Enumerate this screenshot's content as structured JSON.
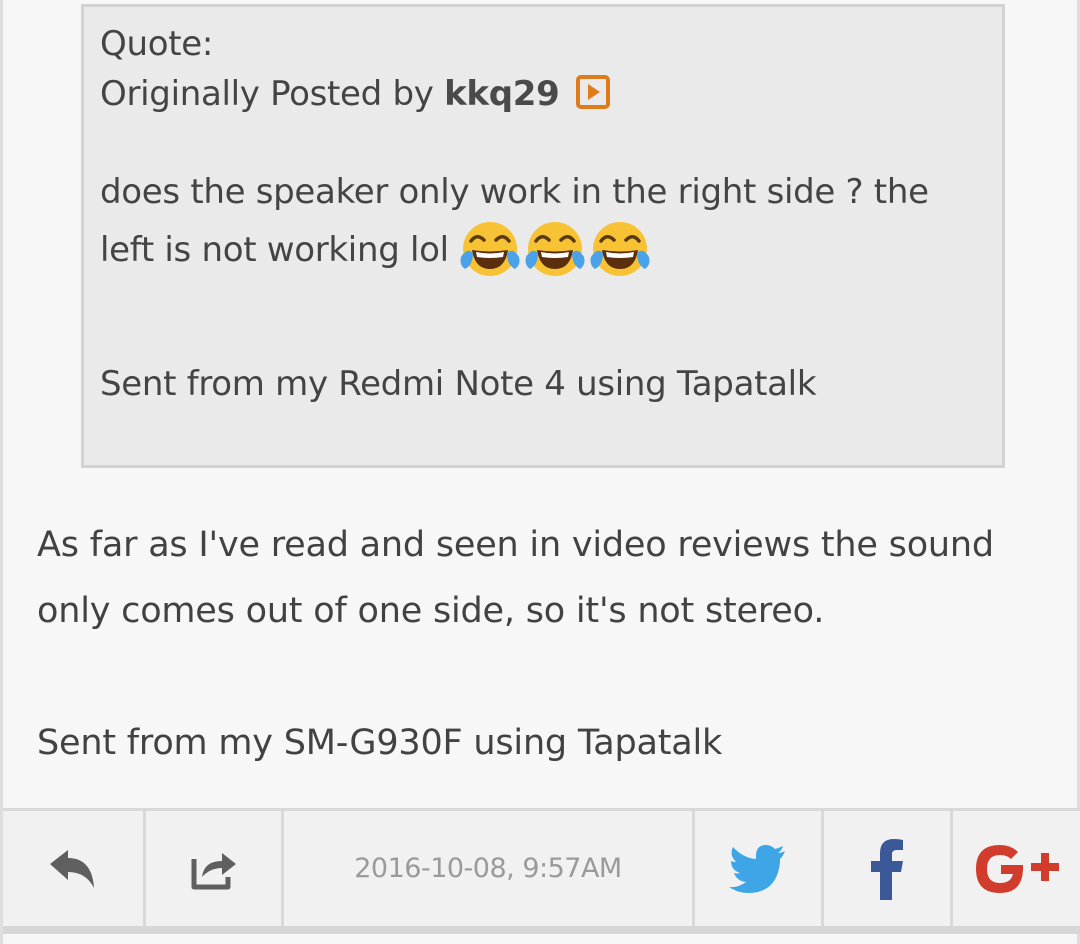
{
  "quote": {
    "label": "Quote:",
    "posted_by_prefix": "Originally Posted by ",
    "author": "kkq29",
    "text_line1": "does the speaker only work in the right side ? the",
    "text_line2": "left is not working lol",
    "emojis": [
      "face-with-tears-of-joy",
      "face-with-tears-of-joy",
      "face-with-tears-of-joy"
    ],
    "signature": "Sent from my Redmi Note 4 using Tapatalk"
  },
  "message": {
    "line1": "As far as I've read and seen in video reviews the sound",
    "line2": "only comes out of one side, so it's not stereo.",
    "signature": "Sent from my SM-G930F using Tapatalk"
  },
  "footer": {
    "timestamp": "2016-10-08, 9:57AM",
    "icons": [
      "reply-icon",
      "share-icon",
      "twitter-icon",
      "facebook-icon",
      "google-plus-icon"
    ]
  },
  "colors": {
    "view_post_orange": "#e07b1a",
    "twitter_blue": "#3ea6e6",
    "facebook_blue": "#3b5998",
    "google_red": "#d23c2c",
    "icon_gray": "#5f5f5f"
  }
}
